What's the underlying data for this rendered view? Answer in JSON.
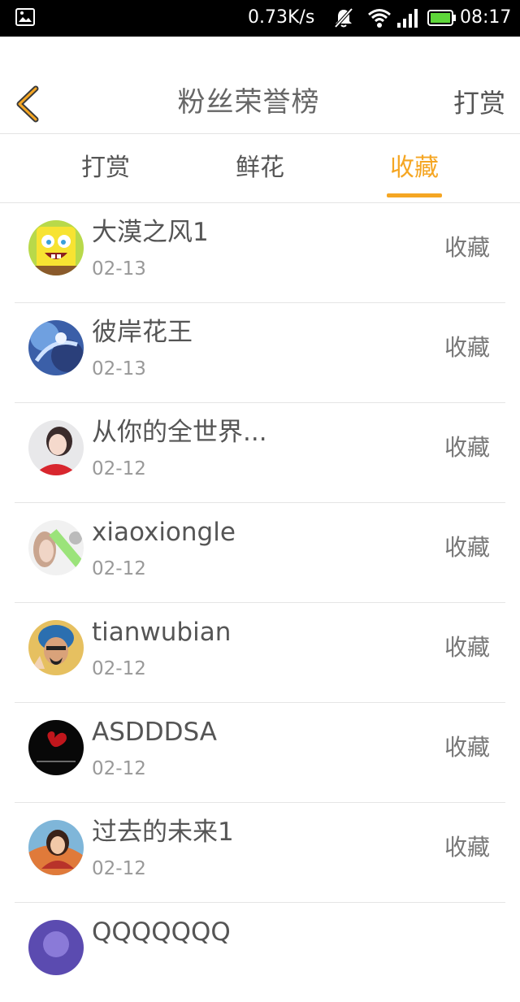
{
  "status_bar": {
    "speed": "0.73K/s",
    "time": "08:17",
    "icons": [
      "gallery-icon",
      "bell-muted-icon",
      "wifi-icon",
      "signal-icon",
      "battery-icon"
    ]
  },
  "header": {
    "title": "粉丝荣誉榜",
    "action_label": "打赏",
    "back_icon": "chevron-left-icon"
  },
  "tabs": [
    {
      "label": "打赏",
      "active": false
    },
    {
      "label": "鲜花",
      "active": false
    },
    {
      "label": "收藏",
      "active": true
    }
  ],
  "colors": {
    "accent": "#f5a623",
    "text_primary": "#555555",
    "text_secondary": "#999999"
  },
  "fans": [
    {
      "name": "大漠之风1",
      "date": "02-13",
      "action": "收藏"
    },
    {
      "name": "彼岸花王",
      "date": "02-13",
      "action": "收藏"
    },
    {
      "name": "从你的全世界...",
      "date": "02-12",
      "action": "收藏"
    },
    {
      "name": "xiaoxiongle",
      "date": "02-12",
      "action": "收藏"
    },
    {
      "name": "tianwubian",
      "date": "02-12",
      "action": "收藏"
    },
    {
      "name": "ASDDDSA",
      "date": "02-12",
      "action": "收藏"
    },
    {
      "name": "过去的未来1",
      "date": "02-12",
      "action": "收藏"
    },
    {
      "name": "QQQQQQQ",
      "date": "",
      "action": ""
    }
  ]
}
